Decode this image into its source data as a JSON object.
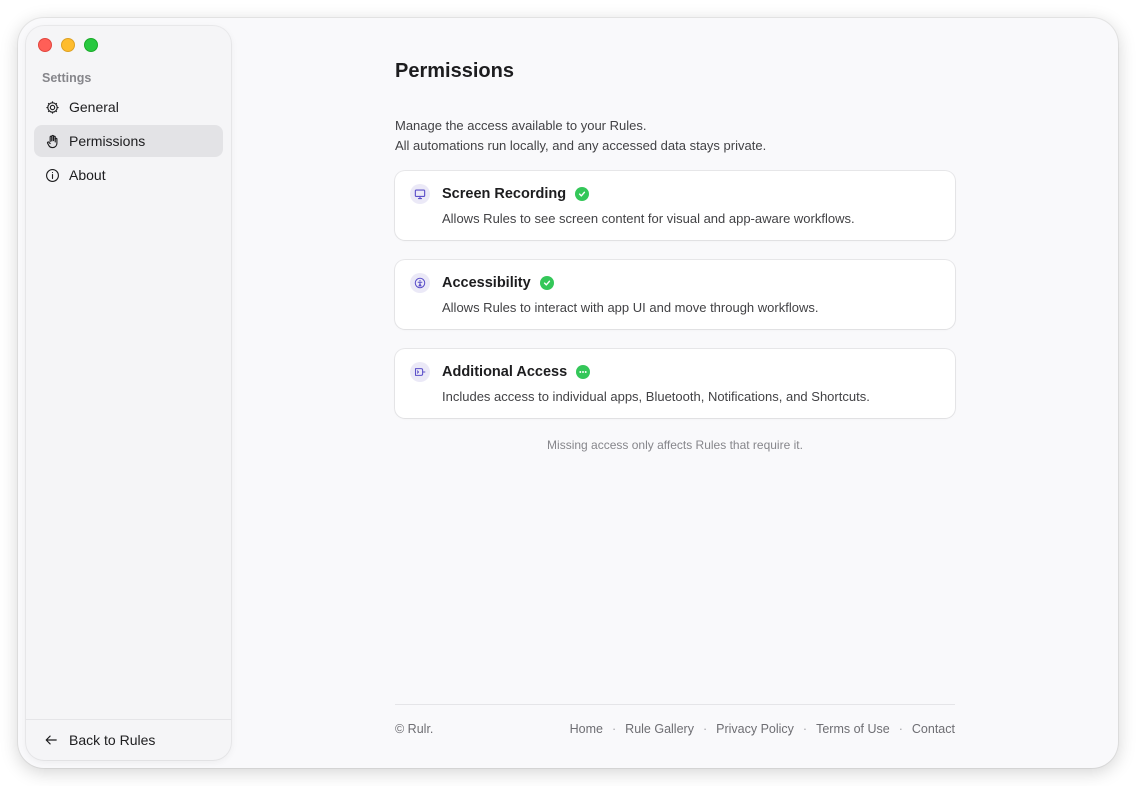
{
  "sidebar": {
    "section_label": "Settings",
    "items": [
      {
        "label": "General",
        "icon": "gear-icon"
      },
      {
        "label": "Permissions",
        "icon": "hand-icon",
        "active": true
      },
      {
        "label": "About",
        "icon": "info-icon"
      }
    ],
    "back_label": "Back to Rules"
  },
  "main": {
    "title": "Permissions",
    "description_line1": "Manage the access available to your Rules.",
    "description_line2": "All automations run locally, and any accessed data stays private.",
    "cards": [
      {
        "title": "Screen Recording",
        "description": "Allows Rules to see screen content for visual and app-aware workflows.",
        "icon": "display-icon",
        "status": "granted-check-icon"
      },
      {
        "title": "Accessibility",
        "description": "Allows Rules to interact with app UI and move through workflows.",
        "icon": "accessibility-icon",
        "status": "granted-check-icon"
      },
      {
        "title": "Additional Access",
        "description": "Includes access to individual apps, Bluetooth, Notifications, and Shortcuts.",
        "icon": "connector-icon",
        "status": "more-ellipsis-icon"
      }
    ],
    "note": "Missing access only affects Rules that require it."
  },
  "footer": {
    "copyright": "© Rulr.",
    "links": [
      "Home",
      "Rule Gallery",
      "Privacy Policy",
      "Terms of Use",
      "Contact"
    ],
    "separator": "·"
  },
  "colors": {
    "accent_purple": "#5b4fc9",
    "icon_bg": "#ebe9f7",
    "status_green": "#34c759"
  }
}
